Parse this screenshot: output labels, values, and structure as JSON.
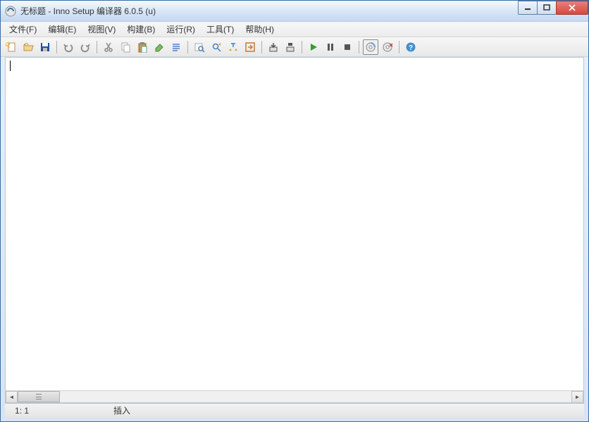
{
  "window": {
    "title": "无标题 - Inno Setup 编译器 6.0.5 (u)"
  },
  "menu": {
    "file": "文件(F)",
    "edit": "编辑(E)",
    "view": "视图(V)",
    "build": "构建(B)",
    "run": "运行(R)",
    "tools": "工具(T)",
    "help": "帮助(H)"
  },
  "status": {
    "position": "1:   1",
    "mode": "插入"
  }
}
